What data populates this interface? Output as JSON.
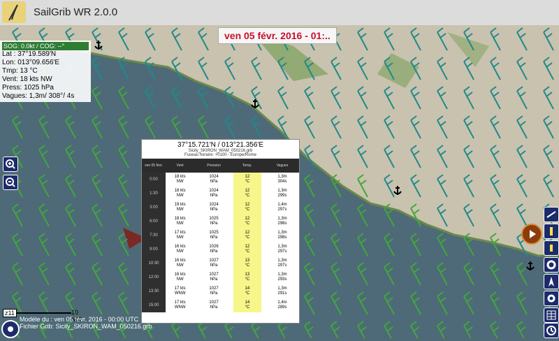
{
  "app": {
    "title": "SailGrib WR 2.0.0"
  },
  "date_banner": "ven 05 févr. 2016 - 01:..",
  "info": {
    "header": "SOG: 0.0kt / COG: --°",
    "lat": "Lat : 37°19.589'N",
    "lon": "Lon: 013°09.656'E",
    "temp": "Tmp: 13 °C",
    "wind": "Vent: 18 kts  NW",
    "pressure": "Press: 1025 hPa",
    "waves": "Vagues: 1,3m/ 308°/ 4s"
  },
  "popup": {
    "coords": "37°15.721'N / 013°21.356'E",
    "file": "Sicily_SKIRON_WAM_050216.grb",
    "timezone": "Fuseau horaire: +0100 - Europe/Rome",
    "columns": [
      "ven 05 févr.",
      "Vent",
      "Pression",
      "Temp.",
      "Vagues"
    ],
    "rows": [
      {
        "time": "0:00",
        "wind": "18 kts",
        "dir": "NW",
        "press": "1024",
        "unit": "hPa",
        "temp": "12",
        "tunit": "°C",
        "wave": "1,3m",
        "wdir": "304s"
      },
      {
        "time": "1:30",
        "wind": "18 kts",
        "dir": "NW",
        "press": "1024",
        "unit": "hPa",
        "temp": "12",
        "tunit": "°C",
        "wave": "1,3m",
        "wdir": "299s"
      },
      {
        "time": "3:00",
        "wind": "19 kts",
        "dir": "NW",
        "press": "1024",
        "unit": "hPa",
        "temp": "12",
        "tunit": "°C",
        "wave": "1,4m",
        "wdir": "297s"
      },
      {
        "time": "6:00",
        "wind": "18 kts",
        "dir": "NW",
        "press": "1025",
        "unit": "hPa",
        "temp": "12",
        "tunit": "°C",
        "wave": "1,3m",
        "wdir": "298s"
      },
      {
        "time": "7:30",
        "wind": "17 kts",
        "dir": "NW",
        "press": "1025",
        "unit": "hPa",
        "temp": "12",
        "tunit": "°C",
        "wave": "1,3m",
        "wdir": "298s"
      },
      {
        "time": "9:00",
        "wind": "16 kts",
        "dir": "NW",
        "press": "1026",
        "unit": "hPa",
        "temp": "12",
        "tunit": "°C",
        "wave": "1,3m",
        "wdir": "297s"
      },
      {
        "time": "10:30",
        "wind": "16 kts",
        "dir": "NW",
        "press": "1027",
        "unit": "hPa",
        "temp": "13",
        "tunit": "°C",
        "wave": "1,3m",
        "wdir": "297s"
      },
      {
        "time": "12:00",
        "wind": "16 kts",
        "dir": "NW",
        "press": "1027",
        "unit": "hPa",
        "temp": "13",
        "tunit": "°C",
        "wave": "1,3m",
        "wdir": "293s"
      },
      {
        "time": "13:30",
        "wind": "17 kts",
        "dir": "WNW",
        "press": "1027",
        "unit": "hPa",
        "temp": "14",
        "tunit": "°C",
        "wave": "1,3m",
        "wdir": "291s"
      },
      {
        "time": "15:00",
        "wind": "17 kts",
        "dir": "WNW",
        "press": "1027",
        "unit": "hPa",
        "temp": "14",
        "tunit": "°C",
        "wave": "1,4m",
        "wdir": "289s"
      }
    ]
  },
  "scale": {
    "zoom": "z11",
    "distance": "10 NM"
  },
  "footer": {
    "line1": "Modèle du : ven 05 févr. 2016 - 00:00 UTC",
    "line2": "Fichier Grib: Sicily_SKIRON_WAM_050216.grb"
  },
  "colors": {
    "wind_green": "#3fa83a",
    "wind_teal": "#1f8a8a",
    "land": "#c9c2ae",
    "sea": "#4e6a78",
    "banner_red": "#c8102e"
  }
}
